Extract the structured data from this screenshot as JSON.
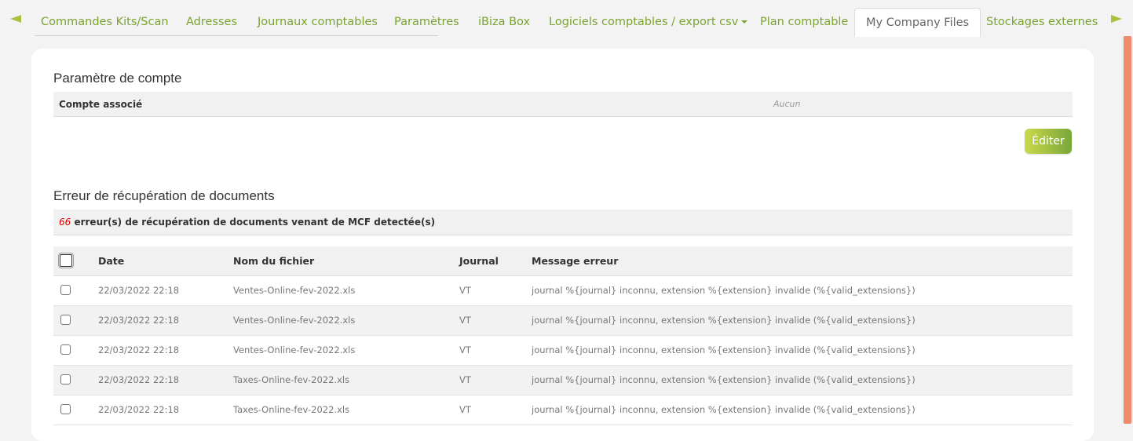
{
  "tabs": [
    {
      "label": "Commandes Kits/Scan"
    },
    {
      "label": "Adresses"
    },
    {
      "label": "Journaux comptables"
    },
    {
      "label": "Paramètres"
    },
    {
      "label": "iBiza Box"
    },
    {
      "label": "Logiciels comptables / export csv"
    },
    {
      "label": "Plan comptable"
    },
    {
      "label": "My Company Files"
    },
    {
      "label": "Stockages externes"
    }
  ],
  "account": {
    "title": "Paramètre de compte",
    "row_label": "Compte associé",
    "row_value": "Aucun",
    "edit_label": "Éditer"
  },
  "errors": {
    "title": "Erreur de récupération de documents",
    "count": "66",
    "summary_text": " erreur(s) de récupération de documents venant de MCF detectée(s)",
    "columns": {
      "date": "Date",
      "file": "Nom du fichier",
      "journal": "Journal",
      "message": "Message erreur"
    },
    "rows": [
      {
        "date": "22/03/2022 22:18",
        "file": "Ventes-Online-fev-2022.xls",
        "journal": "VT",
        "message": "journal %{journal} inconnu, extension %{extension} invalide (%{valid_extensions})"
      },
      {
        "date": "22/03/2022 22:18",
        "file": "Ventes-Online-fev-2022.xls",
        "journal": "VT",
        "message": "journal %{journal} inconnu, extension %{extension} invalide (%{valid_extensions})"
      },
      {
        "date": "22/03/2022 22:18",
        "file": "Ventes-Online-fev-2022.xls",
        "journal": "VT",
        "message": "journal %{journal} inconnu, extension %{extension} invalide (%{valid_extensions})"
      },
      {
        "date": "22/03/2022 22:18",
        "file": "Taxes-Online-fev-2022.xls",
        "journal": "VT",
        "message": "journal %{journal} inconnu, extension %{extension} invalide (%{valid_extensions})"
      },
      {
        "date": "22/03/2022 22:18",
        "file": "Taxes-Online-fev-2022.xls",
        "journal": "VT",
        "message": "journal %{journal} inconnu, extension %{extension} invalide (%{valid_extensions})"
      }
    ]
  },
  "colors": {
    "accent": "#7ba32f",
    "error_count": "#dd0000",
    "scroll_thumb": "#ee8a6a"
  }
}
